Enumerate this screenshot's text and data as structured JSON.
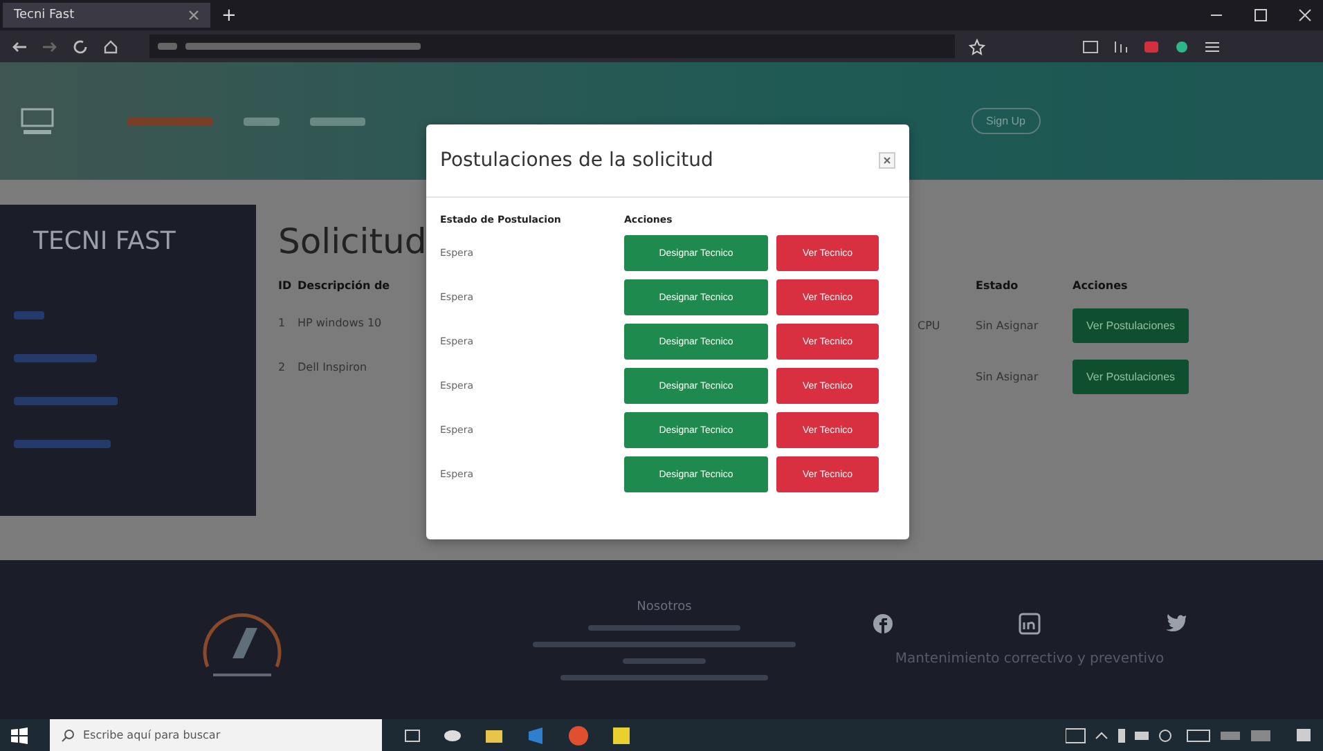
{
  "browser": {
    "tab_title": "Tecni Fast",
    "new_tab": "+"
  },
  "navbar": {
    "signup": "Sign Up"
  },
  "sidebar": {
    "title": "TECNI FAST"
  },
  "content": {
    "heading": "Solicitud",
    "left_columns": [
      "ID",
      "Descripción de"
    ],
    "right_columns": [
      "Estado",
      "Acciones"
    ],
    "rows": [
      {
        "id": "1",
        "description": "HP windows 10",
        "column_3": "CPU",
        "status": "Sin Asignar",
        "action": "Ver Postulaciones"
      },
      {
        "id": "2",
        "description": "Dell Inspiron",
        "column_3": "",
        "status": "Sin Asignar",
        "action": "Ver Postulaciones"
      }
    ]
  },
  "modal": {
    "title": "Postulaciones de la solicitud",
    "columns": [
      "Estado de Postulacion",
      "Acciones"
    ],
    "rows": [
      {
        "status": "Espera",
        "actions": [
          {
            "label": "Designar Tecnico",
            "kind": "success"
          },
          {
            "label": "Ver Tecnico",
            "kind": "danger"
          }
        ]
      },
      {
        "status": "Espera",
        "actions": [
          {
            "label": "Designar Tecnico",
            "kind": "success"
          },
          {
            "label": "Ver Tecnico",
            "kind": "danger"
          }
        ]
      },
      {
        "status": "Espera",
        "actions": [
          {
            "label": "Designar Tecnico",
            "kind": "success"
          },
          {
            "label": "Ver Tecnico",
            "kind": "danger"
          }
        ]
      },
      {
        "status": "Espera",
        "actions": [
          {
            "label": "Designar Tecnico",
            "kind": "success"
          },
          {
            "label": "Ver Tecnico",
            "kind": "danger"
          }
        ]
      },
      {
        "status": "Espera",
        "actions": [
          {
            "label": "Designar Tecnico",
            "kind": "success"
          },
          {
            "label": "Ver Tecnico",
            "kind": "danger"
          }
        ]
      },
      {
        "status": "Espera",
        "actions": [
          {
            "label": "Designar Tecnico",
            "kind": "success"
          },
          {
            "label": "Ver Tecnico",
            "kind": "danger"
          }
        ]
      }
    ]
  },
  "footer": {
    "heading": "Nosotros",
    "tagline": "Mantenimiento correctivo y preventivo"
  },
  "taskbar": {
    "search_placeholder": "Escribe aquí para buscar"
  }
}
